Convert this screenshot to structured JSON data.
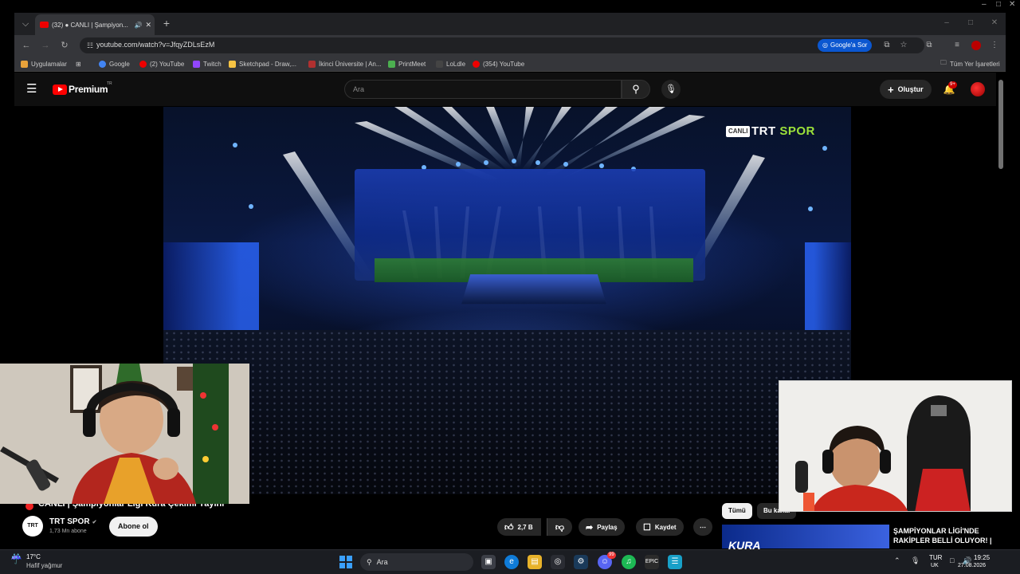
{
  "browser": {
    "tab_title": "(32) ● CANLI | Şampiyon...",
    "url": "youtube.com/watch?v=JfqyZDLsEzM",
    "google_sor": "Google'a Sor",
    "bookmarks": [
      {
        "label": "Uygulamalar",
        "color": "#e8a23a"
      },
      {
        "label": "Google",
        "color": "#4285f4"
      },
      {
        "label": "(2) YouTube",
        "color": "#e00"
      },
      {
        "label": "Twitch",
        "color": "#9146ff"
      },
      {
        "label": "Sketchpad - Draw,...",
        "color": "#f6c343"
      },
      {
        "label": "İkinci Üniversite | An...",
        "color": "#b03030"
      },
      {
        "label": "PrintMeet",
        "color": "#4caf50"
      },
      {
        "label": "LoLdle",
        "color": "#222"
      },
      {
        "label": "(354) YouTube",
        "color": "#e00"
      }
    ],
    "all_bookmarks": "Tüm Yer İşaretleri"
  },
  "youtube": {
    "brand": "Premium",
    "brand_suffix": "TR",
    "search_placeholder": "Ara",
    "create_label": "Oluştur",
    "notif_badge": "9+",
    "overlay_live": "CANLI",
    "overlay_brand_a": "TRT",
    "overlay_brand_b": "SPOR",
    "video_title": "CANLI | Şampiyonlar Ligi Kura Çekimi Yayını",
    "channel_name": "TRT SPOR",
    "channel_avatar_text": "TRT",
    "subscribers": "1,73 Mn abone",
    "subscribe_label": "Abone ol",
    "like_count": "2,7 B",
    "share_label": "Paylaş",
    "save_label": "Kaydet",
    "chip_all": "Tümü",
    "chip_2": "Bu kanal",
    "rec_thumb_text": "KURA",
    "rec_title": "ŞAMPİYONLAR LİGİ'NDE RAKİPLER BELLİ OLUYOR! |"
  },
  "taskbar": {
    "weather_temp": "17°C",
    "weather_desc": "Hafif yağmur",
    "search_label": "Ara",
    "lang_1": "TUR",
    "lang_2": "UK",
    "time": "19:25",
    "date": "27.08.2026",
    "discord_badge": "99"
  }
}
